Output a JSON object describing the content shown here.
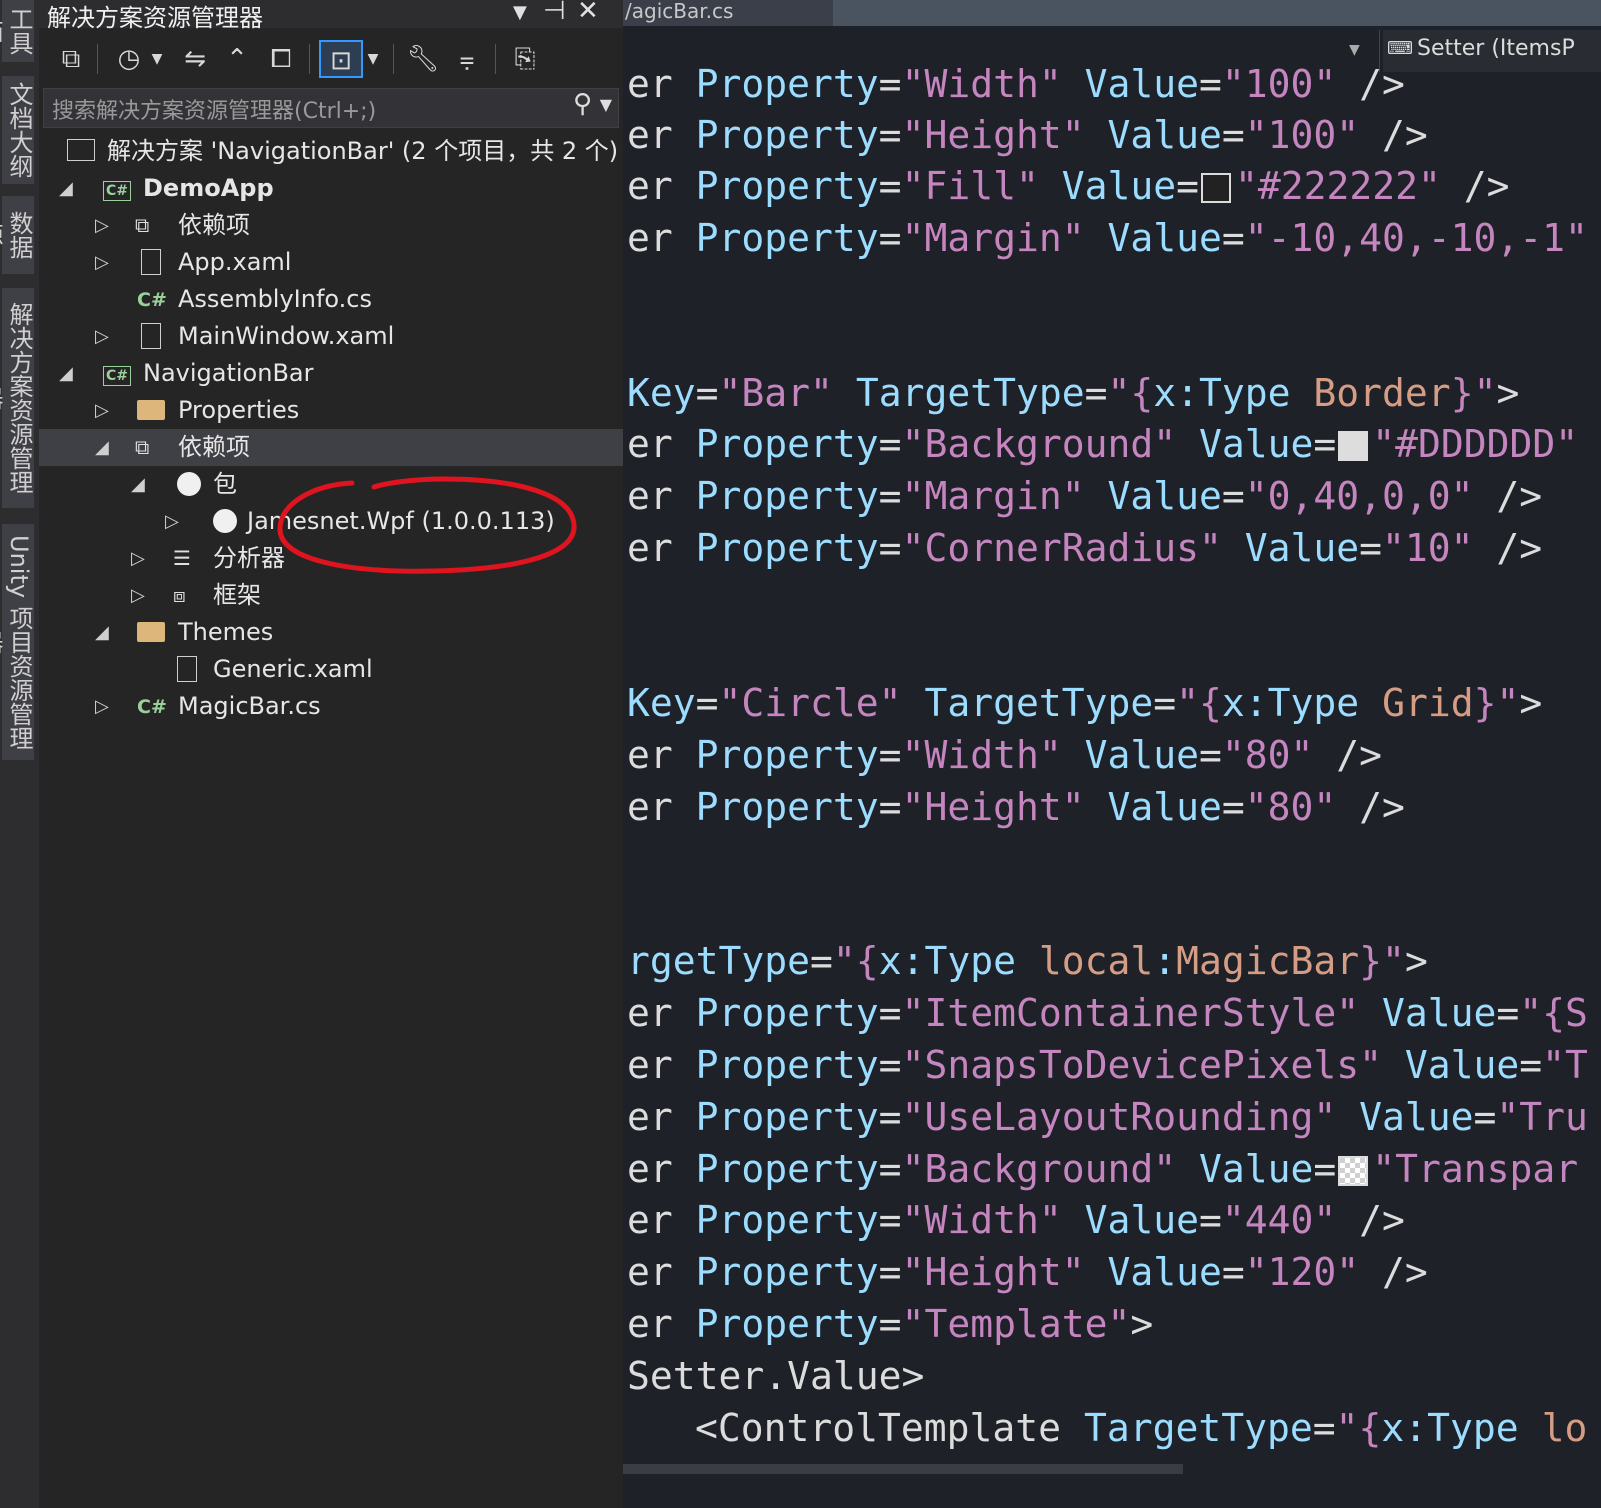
{
  "left_strip": {
    "tabs": [
      "工具箱",
      "文档大纲",
      "数据源",
      "解决方案资源管理器",
      "Unity 项目资源管理器"
    ]
  },
  "solution_explorer": {
    "title": "解决方案资源管理器",
    "search_placeholder": "搜索解决方案资源管理器(Ctrl+;)",
    "solution_label": "解决方案 'NavigationBar' (2 个项目，共 2 个)",
    "tree": {
      "demoapp": "DemoApp",
      "demo_deps": "依赖项",
      "app_xaml": "App.xaml",
      "assemblyinfo": "AssemblyInfo.cs",
      "mainwindow": "MainWindow.xaml",
      "navbar": "NavigationBar",
      "properties": "Properties",
      "nav_deps": "依赖项",
      "packages": "包",
      "jamesnet": "Jamesnet.Wpf (1.0.0.113)",
      "analyzers": "分析器",
      "frameworks": "框架",
      "themes": "Themes",
      "generic": "Generic.xaml",
      "magicbar": "MagicBar.cs"
    },
    "icons": {
      "csharp_box": "C#",
      "csharp_plain": "C#"
    },
    "annotation_color": "#e0141e"
  },
  "editor": {
    "tab_label": "/agicBar.cs",
    "member_dropdown": "Setter (ItemsP",
    "colors": {
      "keyword": "#9cdcfe",
      "string": "#d69d85",
      "string_value": "#c586c0",
      "background": "#1f2129"
    },
    "lines": {
      "l1": [
        "er ",
        "Property",
        "=",
        "\"Width\"",
        " ",
        "Value",
        "=",
        "\"100\"",
        " />"
      ],
      "l2": [
        "er ",
        "Property",
        "=",
        "\"Height\"",
        " ",
        "Value",
        "=",
        "\"100\"",
        " />"
      ],
      "l3": [
        "er ",
        "Property",
        "=",
        "\"Fill\"",
        " ",
        "Value",
        "=",
        "\"#222222\"",
        " />"
      ],
      "l4": [
        "er ",
        "Property",
        "=",
        "\"Margin\"",
        " ",
        "Value",
        "=",
        "\"-10,40,-10,-1\""
      ],
      "l5": [
        "Key",
        "=",
        "\"Bar\"",
        " ",
        "TargetType",
        "=",
        "\"{",
        "x:Type",
        " ",
        "Border",
        "}\"",
        ">"
      ],
      "l6": [
        "er ",
        "Property",
        "=",
        "\"Background\"",
        " ",
        "Value",
        "=",
        "\"#DDDDDD\""
      ],
      "l7": [
        "er ",
        "Property",
        "=",
        "\"Margin\"",
        " ",
        "Value",
        "=",
        "\"0,40,0,0\"",
        " />"
      ],
      "l8": [
        "er ",
        "Property",
        "=",
        "\"CornerRadius\"",
        " ",
        "Value",
        "=",
        "\"10\"",
        " />"
      ],
      "l9": [
        "Key",
        "=",
        "\"Circle\"",
        " ",
        "TargetType",
        "=",
        "\"{",
        "x:Type",
        " ",
        "Grid",
        "}\"",
        ">"
      ],
      "l10": [
        "er ",
        "Property",
        "=",
        "\"Width\"",
        " ",
        "Value",
        "=",
        "\"80\"",
        " />"
      ],
      "l11": [
        "er ",
        "Property",
        "=",
        "\"Height\"",
        " ",
        "Value",
        "=",
        "\"80\"",
        " />"
      ],
      "l12": [
        "rgetType",
        "=",
        "\"{",
        "x:Type",
        " ",
        "local",
        ":",
        "MagicBar",
        "}\"",
        ">"
      ],
      "l13": [
        "er ",
        "Property",
        "=",
        "\"ItemContainerStyle\"",
        " ",
        "Value",
        "=",
        "\"{S"
      ],
      "l14": [
        "er ",
        "Property",
        "=",
        "\"SnapsToDevicePixels\"",
        " ",
        "Value",
        "=",
        "\"T"
      ],
      "l15": [
        "er ",
        "Property",
        "=",
        "\"UseLayoutRounding\"",
        " ",
        "Value",
        "=",
        "\"Tru"
      ],
      "l16": [
        "er ",
        "Property",
        "=",
        "\"Background\"",
        " ",
        "Value",
        "=",
        "\"Transpar"
      ],
      "l17": [
        "er ",
        "Property",
        "=",
        "\"Width\"",
        " ",
        "Value",
        "=",
        "\"440\"",
        " />"
      ],
      "l18": [
        "er ",
        "Property",
        "=",
        "\"Height\"",
        " ",
        "Value",
        "=",
        "\"120\"",
        " />"
      ],
      "l19": [
        "er ",
        "Property",
        "=",
        "\"Template\"",
        ">"
      ],
      "l20": [
        "Setter.Value",
        ">"
      ],
      "l21": [
        "<",
        "ControlTemplate",
        " ",
        "TargetType",
        "=",
        "\"{",
        "x:Type",
        " ",
        "lo"
      ]
    }
  }
}
